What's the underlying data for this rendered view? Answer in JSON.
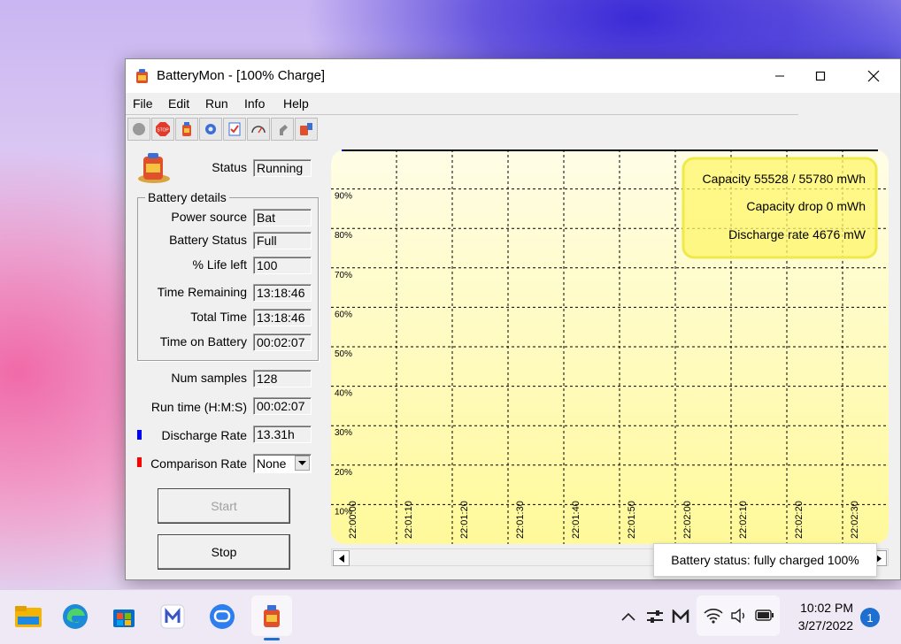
{
  "window": {
    "title": "BatteryMon - [100% Charge]"
  },
  "menu": [
    "File",
    "Edit",
    "Run",
    "Info",
    "Help"
  ],
  "toolbar": [
    "stop-circle-icon",
    "stop-sign-icon",
    "battery-icon",
    "settings-gear-icon",
    "checklist-icon",
    "gauge-icon",
    "plug-icon",
    "battery-info-icon"
  ],
  "panel": {
    "status_label": "Status",
    "status_value": "Running",
    "group_title": "Battery details",
    "details": [
      {
        "label": "Power source",
        "value": "Bat"
      },
      {
        "label": "Battery Status",
        "value": "Full"
      },
      {
        "label": "% Life left",
        "value": "100"
      },
      {
        "label": "Time Remaining",
        "value": "13:18:46"
      },
      {
        "label": "Total Time",
        "value": "13:18:46"
      },
      {
        "label": "Time on Battery",
        "value": "00:02:07"
      }
    ],
    "num_samples_label": "Num samples",
    "num_samples_value": "128",
    "run_time_label": "Run time (H:M:S)",
    "run_time_value": "00:02:07",
    "discharge_label": "Discharge Rate",
    "discharge_value": "13.31h",
    "discharge_color": "#0000ff",
    "comparison_label": "Comparison Rate",
    "comparison_value": "None",
    "comparison_color": "#ff0000",
    "start_label": "Start",
    "stop_label": "Stop"
  },
  "chart_data": {
    "type": "line",
    "y_ticks": [
      "90%",
      "80%",
      "70%",
      "60%",
      "50%",
      "40%",
      "30%",
      "20%",
      "10%"
    ],
    "x_ticks": [
      "22:00:00",
      "22:01:10",
      "22:01:20",
      "22:01:30",
      "22:01:40",
      "22:01:50",
      "22:02:00",
      "22:02:10",
      "22:02:20",
      "22:02:30"
    ],
    "ylim": [
      0,
      100
    ],
    "grid": true,
    "series": [
      {
        "color": "#0000ff",
        "values": [
          100,
          100,
          100,
          100,
          100,
          100,
          100,
          100,
          100,
          100
        ]
      }
    ],
    "info_box": {
      "capacity": "Capacity 55528 / 55780 mWh",
      "capacity_drop": "Capacity drop 0 mWh",
      "discharge_rate": "Discharge rate 4676 mW"
    }
  },
  "tooltip": "Battery status: fully charged 100%",
  "taskbar": {
    "apps": [
      "file-explorer-icon",
      "edge-browser-icon",
      "store-icon",
      "mail-app-icon",
      "chat-app-icon",
      "batterymon-icon"
    ],
    "tray": [
      "chevron-up-icon",
      "sliders-icon",
      "app-tray-icon",
      "wifi-icon",
      "volume-icon",
      "battery-tray-icon"
    ],
    "time": "10:02 PM",
    "date": "3/27/2022",
    "notification_count": "1"
  }
}
